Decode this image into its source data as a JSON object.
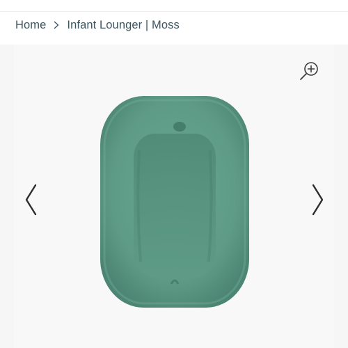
{
  "breadcrumb": {
    "home": "Home",
    "current": "Infant Lounger | Moss"
  },
  "gallery": {
    "zoom_icon": "zoom-in-icon",
    "prev_icon": "chevron-left-icon",
    "next_icon": "chevron-right-icon",
    "product_color": "#5e9b86"
  },
  "colors": {
    "text": "#3d5560",
    "background": "#f6f6f6",
    "product": "#5e9b86"
  }
}
